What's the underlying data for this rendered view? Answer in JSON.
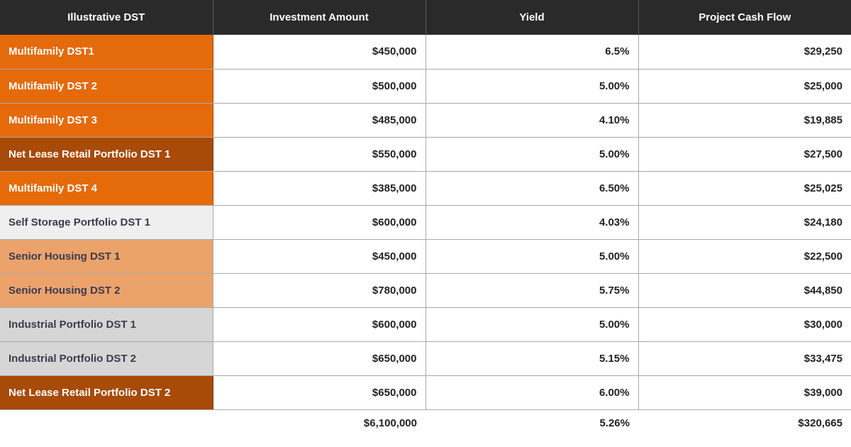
{
  "table": {
    "headers": [
      "Illustrative DST",
      "Investment Amount",
      "Yield",
      "Project Cash Flow"
    ],
    "rows": [
      {
        "name": "Multifamily DST1",
        "investment": "$450,000",
        "yield": "6.5%",
        "cash_flow": "$29,250",
        "tone": "orange"
      },
      {
        "name": "Multifamily DST 2",
        "investment": "$500,000",
        "yield": "5.00%",
        "cash_flow": "$25,000",
        "tone": "orange"
      },
      {
        "name": "Multifamily DST 3",
        "investment": "$485,000",
        "yield": "4.10%",
        "cash_flow": "$19,885",
        "tone": "orange"
      },
      {
        "name": "Net Lease Retail Portfolio DST 1",
        "investment": "$550,000",
        "yield": "5.00%",
        "cash_flow": "$27,500",
        "tone": "brown"
      },
      {
        "name": "Multifamily DST 4",
        "investment": "$385,000",
        "yield": "6.50%",
        "cash_flow": "$25,025",
        "tone": "orange"
      },
      {
        "name": "Self Storage Portfolio DST 1",
        "investment": "$600,000",
        "yield": "4.03%",
        "cash_flow": "$24,180",
        "tone": "lightgrey"
      },
      {
        "name": "Senior Housing DST 1",
        "investment": "$450,000",
        "yield": "5.00%",
        "cash_flow": "$22,500",
        "tone": "peach"
      },
      {
        "name": "Senior Housing DST 2",
        "investment": "$780,000",
        "yield": "5.75%",
        "cash_flow": "$44,850",
        "tone": "peach"
      },
      {
        "name": "Industrial Portfolio DST 1",
        "investment": "$600,000",
        "yield": "5.00%",
        "cash_flow": "$30,000",
        "tone": "grey"
      },
      {
        "name": "Industrial Portfolio DST 2",
        "investment": "$650,000",
        "yield": "5.15%",
        "cash_flow": "$33,475",
        "tone": "grey"
      },
      {
        "name": "Net Lease Retail Portfolio DST 2",
        "investment": "$650,000",
        "yield": "6.00%",
        "cash_flow": "$39,000",
        "tone": "brown"
      }
    ],
    "totals": {
      "investment": "$6,100,000",
      "yield": "5.26%",
      "cash_flow": "$320,665"
    }
  },
  "colors": {
    "header_bg": "#2a2a2a",
    "orange": "#e56a0a",
    "brown": "#a84a08",
    "lightgrey": "#efefef",
    "peach": "#eba36b",
    "grey": "#d6d6d6"
  }
}
